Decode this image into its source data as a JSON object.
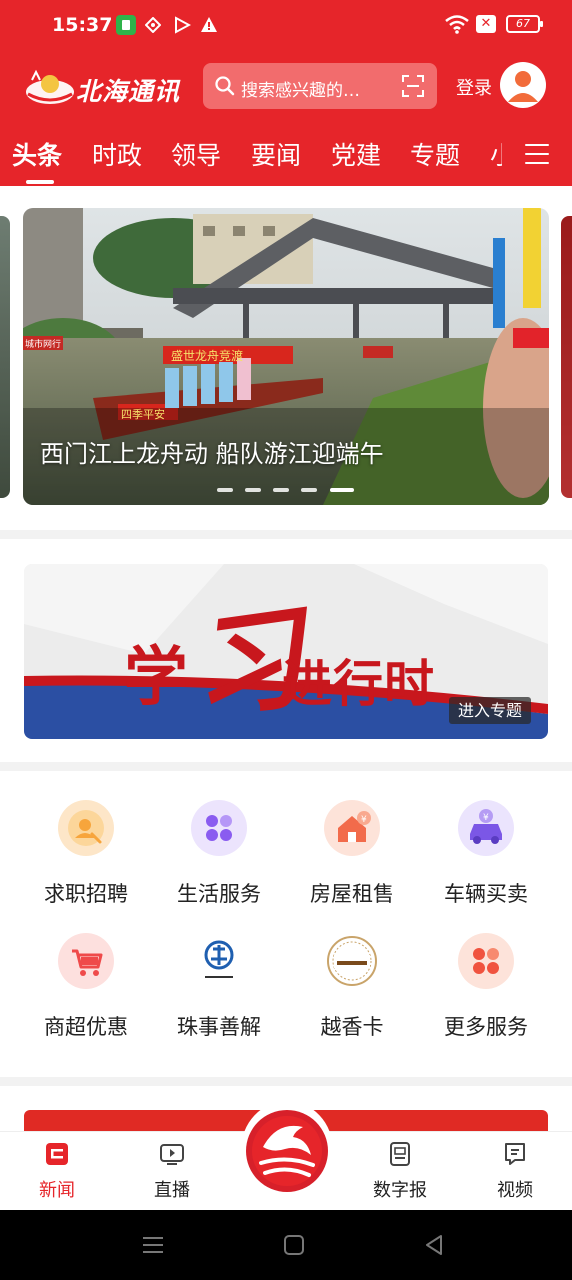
{
  "status_bar": {
    "time": "15:37",
    "battery": "67",
    "icons": [
      "app-notification-icon",
      "diamond-icon",
      "play-store-icon",
      "warning-icon",
      "wifi-icon",
      "no-sim-icon",
      "battery-icon"
    ]
  },
  "header": {
    "logo_text": "北海通讯",
    "search_placeholder": "搜索感兴趣的…",
    "login_label": "登录"
  },
  "tabs": [
    {
      "label": "头条",
      "active": true
    },
    {
      "label": "时政",
      "active": false
    },
    {
      "label": "领导",
      "active": false
    },
    {
      "label": "要闻",
      "active": false
    },
    {
      "label": "党建",
      "active": false
    },
    {
      "label": "专题",
      "active": false
    },
    {
      "label": "小",
      "active": false
    }
  ],
  "carousel": {
    "title": "西门江上龙舟动  船队游江迎端午",
    "boat_banner": "盛世龙舟竞渡",
    "boat_banner_left": "四季平安",
    "side_sign": "城市网行",
    "slide_count": 5,
    "active_slide": 5
  },
  "banner": {
    "title_part1": "学",
    "title_part2": "习",
    "title_part3": "进行时",
    "enter_label": "进入专题"
  },
  "services": [
    {
      "label": "求职招聘",
      "icon": "job-search-icon",
      "color": "#f7a53c"
    },
    {
      "label": "生活服务",
      "icon": "life-service-icon",
      "color": "#8a5cf0"
    },
    {
      "label": "房屋租售",
      "icon": "house-rental-icon",
      "color": "#f26b4b"
    },
    {
      "label": "车辆买卖",
      "icon": "car-trade-icon",
      "color": "#7b57e6"
    },
    {
      "label": "商超优惠",
      "icon": "shopping-cart-icon",
      "color": "#ef4a4a"
    },
    {
      "label": "珠事善解",
      "icon": "zhushi-logo-icon",
      "color": "#1f5fb0"
    },
    {
      "label": "越香卡",
      "icon": "yuexiangka-logo-icon",
      "color": "#7a4a1c"
    },
    {
      "label": "更多服务",
      "icon": "more-services-icon",
      "color": "#f0533f"
    }
  ],
  "bottom_nav": [
    {
      "label": "新闻",
      "icon": "news-icon",
      "active": true
    },
    {
      "label": "直播",
      "icon": "live-tv-icon",
      "active": false
    },
    {
      "label": "数字报",
      "icon": "digital-paper-icon",
      "active": false
    },
    {
      "label": "视频",
      "icon": "video-icon",
      "active": false
    }
  ],
  "colors": {
    "brand_red": "#e6252a",
    "banner_red": "#c8171d",
    "banner_blue": "#2b4fa3"
  }
}
